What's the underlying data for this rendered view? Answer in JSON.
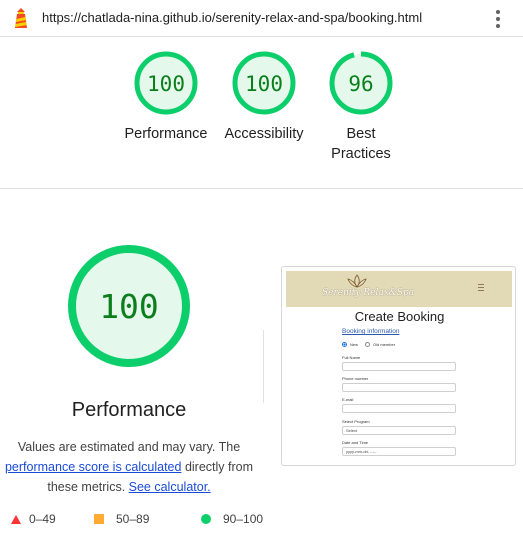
{
  "browser": {
    "url": "https://chatlada-nina.github.io/serenity-relax-and-spa/booking.html",
    "logo_icon": "lighthouse-icon",
    "menu_icon": "kebab-menu-icon"
  },
  "summary_scores": [
    {
      "score": "100",
      "label": "Performance"
    },
    {
      "score": "100",
      "label": "Accessibility"
    },
    {
      "score": "96",
      "label_line1": "Best",
      "label_line2": "Practices"
    }
  ],
  "main": {
    "score": "100",
    "score_fraction": 1.0,
    "title": "Performance",
    "desc_part1": "Values are estimated and may vary. The ",
    "desc_link1": "performance score is calculated",
    "desc_part2": " directly from these metrics. ",
    "desc_link2": "See calculator."
  },
  "legend": {
    "fail": "0–49",
    "average": "50–89",
    "pass": "90–100"
  },
  "screenshot": {
    "brand": "Serenity Relax&Spa",
    "heading": "Create Booking",
    "section": "Booking information",
    "radio_new": "New",
    "radio_old": "Old member",
    "full_name": "Full Name",
    "phone": "Phone number",
    "email": "E-mail",
    "program": "Select Program",
    "program_value": "Select",
    "datetime": "Date and Time",
    "datetime_value": "yyyy-mm-dd, --:--"
  },
  "colors": {
    "pass": "#0cce6b",
    "pass_text": "#0a7f1c",
    "pass_fill": "#e5f8ec",
    "average": "#ffaa33",
    "fail": "#ff3333"
  }
}
